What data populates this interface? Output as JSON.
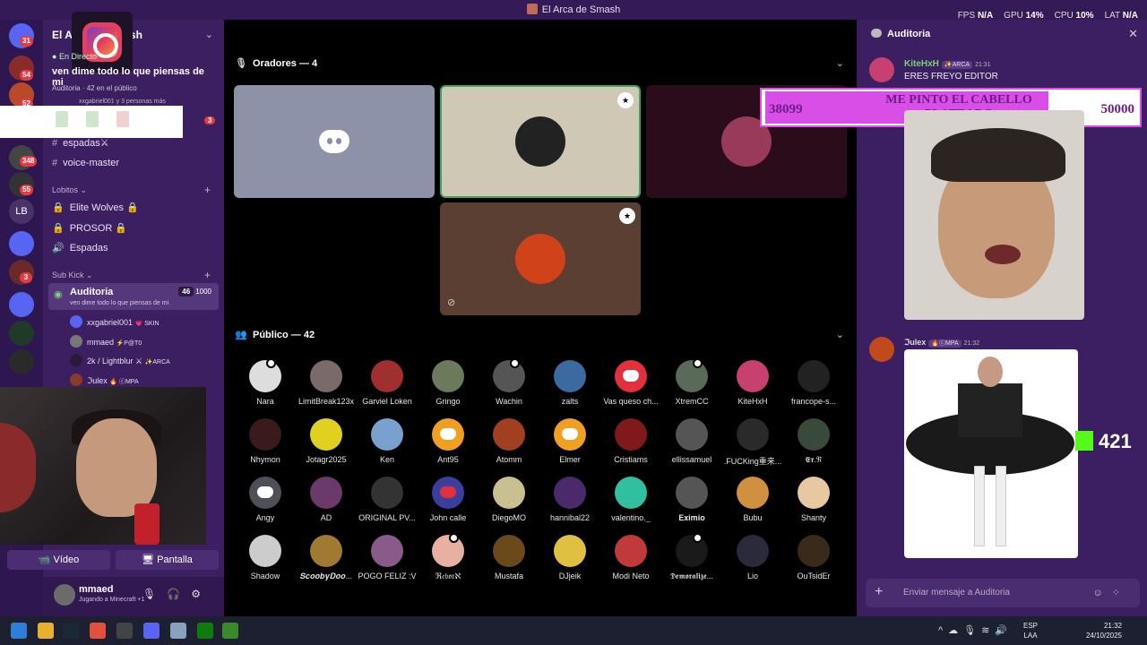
{
  "window": {
    "title": "El Arca de Smash"
  },
  "stats": [
    {
      "label": "FPS",
      "value": "N/A"
    },
    {
      "label": "GPU",
      "value": "14%"
    },
    {
      "label": "CPU",
      "value": "10%"
    },
    {
      "label": "LAT",
      "value": "N/A"
    }
  ],
  "rail": {
    "badges": [
      "31",
      "54",
      "52",
      "348",
      "55",
      "LB",
      "3"
    ]
  },
  "sidebar": {
    "server_name": "El Arca de Smash",
    "live_label": "En Directo",
    "live_title": "ven dime todo lo que piensas de mi",
    "live_channel": "Auditoria",
    "live_count": "42 en el público",
    "live_people": "xxgabriel001 y 3 personas más",
    "unread_badge": "3",
    "channels_top": [
      {
        "label": "espadas⚔"
      },
      {
        "label": "voice-master"
      }
    ],
    "cat1": "Lobitos",
    "cat1_channels": [
      {
        "label": "Elite Wolves 🔒"
      },
      {
        "label": "PROSOR 🔒"
      },
      {
        "label": "Espadas"
      }
    ],
    "cat2": "Sub Kick",
    "voice_channel": {
      "name": "Auditoria",
      "desc": "ven dime todo lo que piensas de mi",
      "count": "46",
      "limit": "1000"
    },
    "voice_users": [
      {
        "name": "xxgabriel001",
        "tag": "💗 SKIN"
      },
      {
        "name": "mmaed",
        "tag": "⚡P@T0"
      },
      {
        "name": "2k / Lightblur ⚔",
        "tag": "✨ARCA"
      },
      {
        "name": "ℑulex",
        "tag": "🔥 ⓒMPA"
      }
    ],
    "btn_video": "Vídeo",
    "btn_screen": "Pantalla",
    "user_name": "mmaed",
    "user_status": "Jugando a Minecraft +1"
  },
  "main": {
    "speakers_title": "Oradores — 4",
    "audience_title": "Público — 42",
    "audience": [
      {
        "name": "Nara"
      },
      {
        "name": "LimitBreak123x"
      },
      {
        "name": "Garviel Loken"
      },
      {
        "name": "Gringo"
      },
      {
        "name": "Wachin"
      },
      {
        "name": "zalts"
      },
      {
        "name": "Vas queso ch..."
      },
      {
        "name": "XtremCC"
      },
      {
        "name": "KiteHxH"
      },
      {
        "name": "francope-s..."
      },
      {
        "name": "Nhymon"
      },
      {
        "name": "Jotagr2025"
      },
      {
        "name": "Ken"
      },
      {
        "name": "Ant95"
      },
      {
        "name": "Atomm"
      },
      {
        "name": "Elmer"
      },
      {
        "name": "Cristiams"
      },
      {
        "name": "ellissamuel"
      },
      {
        "name": ".FUCKing重来..."
      },
      {
        "name": "𝕰𝖗.ℜ"
      },
      {
        "name": "Angy"
      },
      {
        "name": "AD"
      },
      {
        "name": "ORIGINAL PV..."
      },
      {
        "name": "John calle"
      },
      {
        "name": "DiegoMO"
      },
      {
        "name": "hannibal22"
      },
      {
        "name": "valentino._"
      },
      {
        "name": "𝐄𝐱𝐢𝐦𝐢𝐨"
      },
      {
        "name": "Bubu"
      },
      {
        "name": "Shanty"
      },
      {
        "name": "Shadow"
      },
      {
        "name": "𝑺𝒄𝒐𝒐𝒃𝒚𝑫𝒐𝒐..."
      },
      {
        "name": "POGO FELIZ :V"
      },
      {
        "name": "ℜ𝔢𝔟𝔬𝔯ℵ"
      },
      {
        "name": "Mustafa"
      },
      {
        "name": "DJjeik"
      },
      {
        "name": "Modi Neto"
      },
      {
        "name": "𝕯𝖊𝖒𝖔𝖗𝖆𝖑𝖎𝖟𝖊..."
      },
      {
        "name": "Lio"
      },
      {
        "name": "OuTsidEr"
      }
    ]
  },
  "right": {
    "title": "Auditoria",
    "msg1": {
      "name": "KiteHxH",
      "tag": "✨ARCA",
      "time": "21:31",
      "text": "ERES FREYO EDITOR"
    },
    "msg2": {
      "name": "ℑulex",
      "tag": "🔥ⓒMPA",
      "time": "21:32"
    },
    "overlay": {
      "left": "38099",
      "title": "ME PINTO EL CABELLO PLATEADO",
      "right": "50000"
    },
    "kick_count": "421",
    "input_placeholder": "Enviar mensaje a Auditoria"
  },
  "taskbar": {
    "lang1": "ESP",
    "lang2": "LAA",
    "time": "21:32",
    "date": "24/10/2025"
  },
  "colors": {
    "accent": "#5865f2",
    "kick": "#53fc18",
    "overlay": "#d84ee6"
  }
}
